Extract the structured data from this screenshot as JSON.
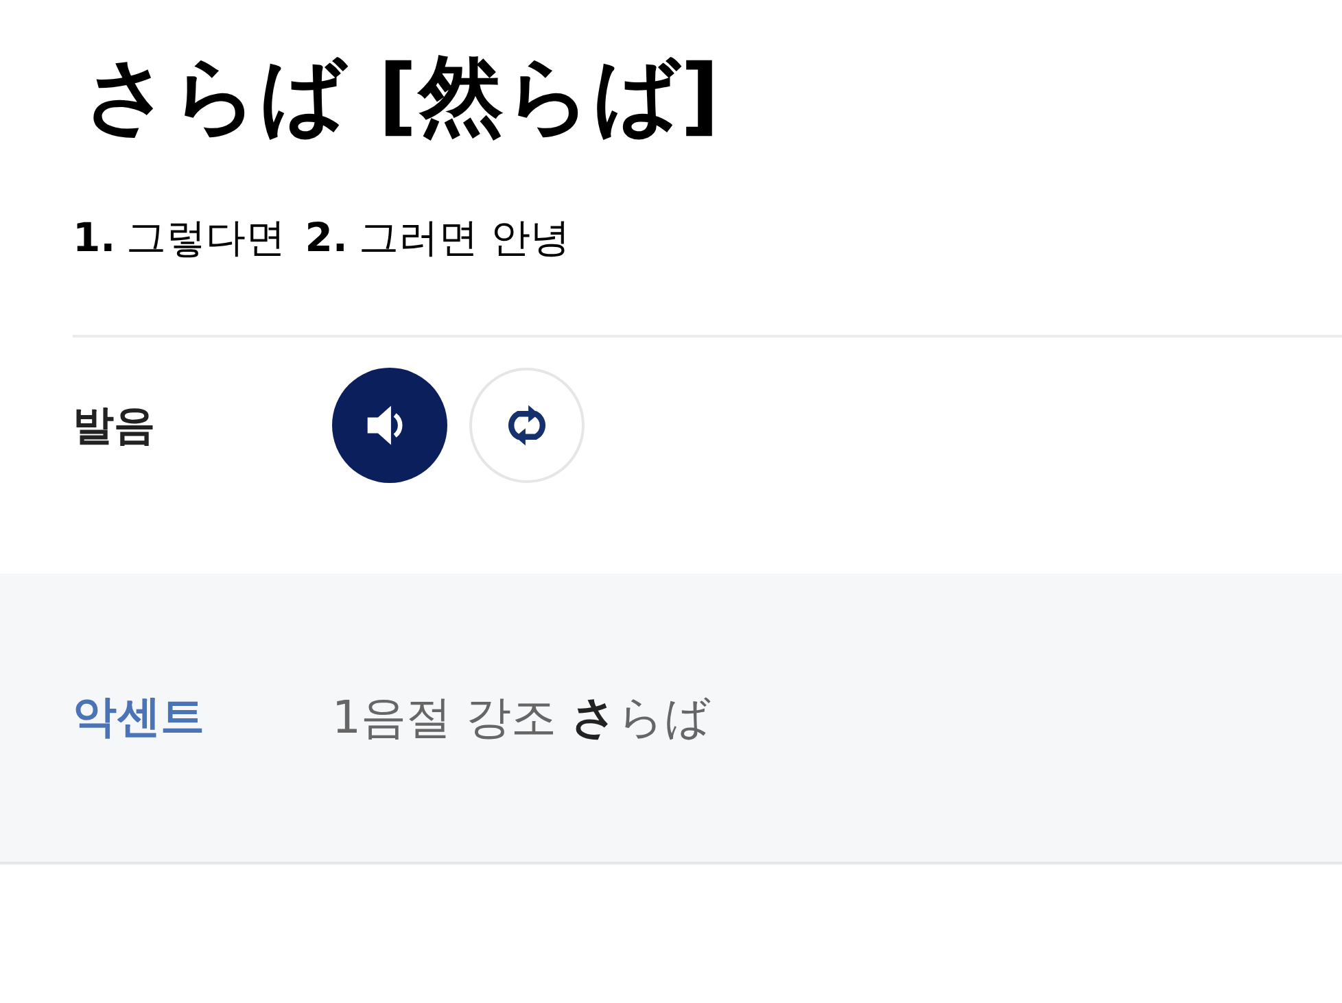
{
  "headword": "さらば [然らば]",
  "senses": [
    {
      "number": "1.",
      "text": "그렇다면"
    },
    {
      "number": "2.",
      "text": "그러면 안녕"
    }
  ],
  "pronunciation": {
    "label": "발음",
    "buttons": [
      {
        "kind": "play"
      },
      {
        "kind": "repeat"
      }
    ]
  },
  "accent": {
    "label": "악센트",
    "text": "1음절 강조 **さ**らば"
  }
}
